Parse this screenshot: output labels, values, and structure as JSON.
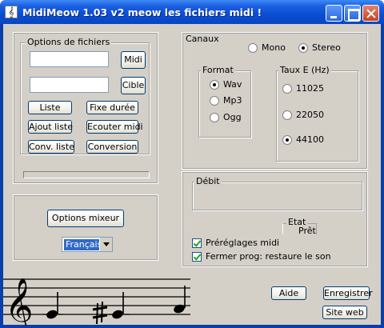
{
  "window": {
    "title": "MidiMeow 1.03 v2 meow les fichiers midi !",
    "app_icon_glyph": "𝄞"
  },
  "file_options": {
    "group_label": "Options de fichiers",
    "source_value": "",
    "target_value": "",
    "midi_button": "Midi",
    "cible_button": "Cible",
    "liste_button": "Liste",
    "fixe_duree_button": "Fixe durée",
    "ajout_liste_button": "Ajout liste",
    "ecouter_midi_button": "Ecouter midi",
    "conv_liste_button": "Conv. liste",
    "conversion_button": "Conversion",
    "progress": 0
  },
  "mixer": {
    "options_button": "Options mixeur",
    "language_value": "Français"
  },
  "channels": {
    "group_label": "Canaux",
    "mono_label": "Mono",
    "stereo_label": "Stereo",
    "selected": "Stereo"
  },
  "format": {
    "group_label": "Format",
    "options": [
      "Wav",
      "Mp3",
      "Ogg"
    ],
    "selected": "Wav"
  },
  "sample_rate": {
    "group_label": "Taux E (Hz)",
    "options": [
      "11025",
      "22050",
      "44100"
    ],
    "selected": "44100"
  },
  "status": {
    "debit_label": "Débit",
    "debit_value": "",
    "etat_label": "Etat",
    "etat_value": "Prêt",
    "presets_label": "Préréglages midi",
    "presets_checked": true,
    "restore_label": "Fermer prog: restaure le son",
    "restore_checked": true
  },
  "bottom_buttons": {
    "aide": "Aide",
    "enregistrer": "Enregistrer",
    "site_web": "Site web"
  },
  "colors": {
    "titlebar": "#0a4ed4",
    "dialog_bg": "#d4d0c8",
    "selection": "#316ac5"
  }
}
